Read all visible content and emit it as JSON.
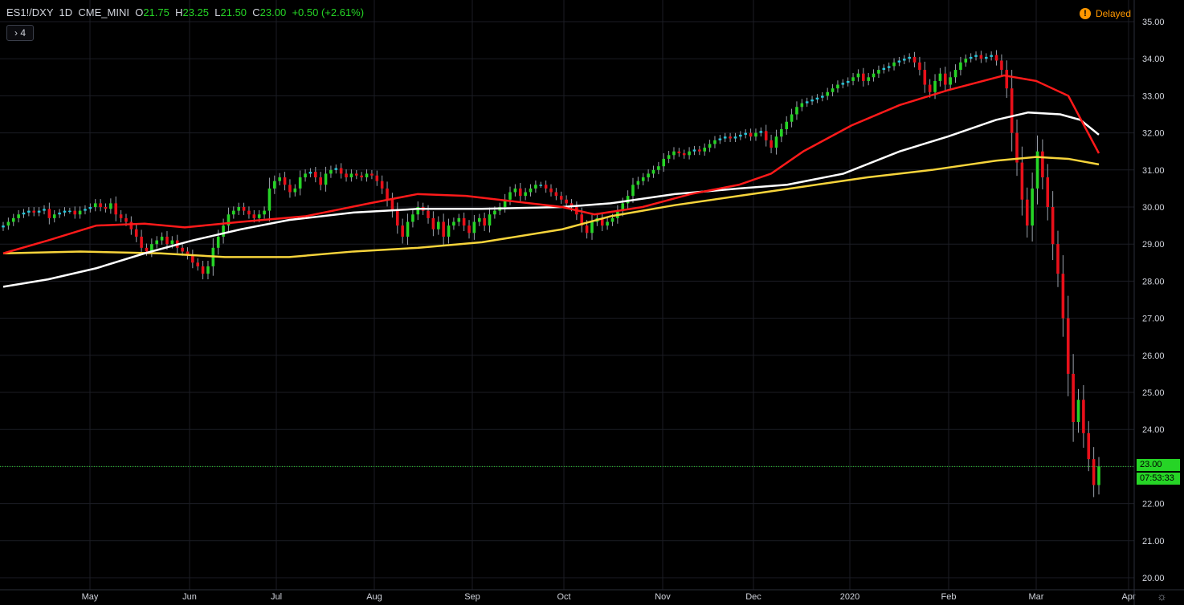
{
  "header": {
    "symbol": "ES1!/DXY",
    "interval": "1D",
    "exchange": "CME_MINI",
    "o_label": "O",
    "o": "21.75",
    "h_label": "H",
    "h": "23.25",
    "l_label": "L",
    "l": "21.50",
    "c_label": "C",
    "c": "23.00",
    "change": "+0.50 (+2.61%)",
    "indicator_toggle": "› 4",
    "delayed": "Delayed"
  },
  "price_tag": {
    "last": "23.00",
    "countdown": "07:53:33"
  },
  "colors": {
    "up": "#26d426",
    "down": "#e8101a",
    "up_weak": "#26c6da",
    "ma_red": "#ff1a1a",
    "ma_white": "#ffffff",
    "ma_yellow": "#f7d43b",
    "grid": "#1b1d24",
    "axis_text": "#d1d4dc",
    "last_line": "#26d426"
  },
  "chart_data": {
    "type": "candlestick",
    "y_ticks": [
      "20.00",
      "21.00",
      "22.00",
      "23.00",
      "24.00",
      "25.00",
      "26.00",
      "27.00",
      "28.00",
      "29.00",
      "30.00",
      "31.00",
      "32.00",
      "33.00",
      "34.00",
      "35.00"
    ],
    "x_labels": [
      "May",
      "Jun",
      "Jul",
      "Aug",
      "Sep",
      "Oct",
      "Nov",
      "Dec",
      "2020",
      "Feb",
      "Mar",
      "Apr"
    ],
    "ylim": [
      20,
      35.3
    ],
    "last_price": 23.0,
    "closes": [
      29.5,
      29.6,
      29.7,
      29.8,
      29.85,
      29.9,
      29.85,
      29.9,
      29.95,
      29.7,
      29.8,
      29.85,
      29.9,
      29.9,
      29.8,
      29.9,
      29.95,
      30.0,
      30.1,
      30.0,
      29.95,
      30.1,
      29.8,
      29.7,
      29.6,
      29.4,
      29.2,
      28.9,
      28.8,
      29.0,
      29.1,
      29.2,
      29.0,
      29.1,
      28.9,
      28.8,
      28.7,
      28.5,
      28.4,
      28.2,
      28.4,
      28.9,
      29.2,
      29.5,
      29.8,
      29.9,
      30.0,
      29.9,
      29.8,
      29.7,
      29.8,
      29.9,
      30.5,
      30.7,
      30.8,
      30.6,
      30.4,
      30.5,
      30.8,
      30.9,
      30.95,
      30.8,
      30.6,
      30.9,
      31.0,
      31.05,
      30.9,
      30.8,
      30.9,
      30.85,
      30.8,
      30.9,
      30.85,
      30.7,
      30.5,
      30.2,
      29.9,
      29.5,
      29.2,
      29.6,
      29.8,
      30.0,
      29.9,
      29.7,
      29.4,
      29.6,
      29.2,
      29.5,
      29.6,
      29.7,
      29.5,
      29.3,
      29.6,
      29.7,
      29.5,
      29.8,
      29.9,
      30.0,
      30.2,
      30.4,
      30.5,
      30.3,
      30.4,
      30.5,
      30.6,
      30.6,
      30.5,
      30.4,
      30.3,
      30.2,
      30.1,
      30.0,
      29.8,
      29.5,
      29.3,
      29.6,
      29.7,
      29.5,
      29.6,
      29.7,
      29.9,
      30.1,
      30.3,
      30.6,
      30.7,
      30.8,
      30.9,
      31.0,
      31.1,
      31.3,
      31.4,
      31.5,
      31.45,
      31.4,
      31.5,
      31.55,
      31.5,
      31.6,
      31.7,
      31.8,
      31.85,
      31.9,
      31.85,
      31.9,
      31.95,
      32.0,
      31.9,
      32.0,
      32.05,
      31.8,
      31.6,
      31.9,
      32.1,
      32.3,
      32.5,
      32.7,
      32.8,
      32.85,
      32.9,
      32.95,
      33.0,
      33.1,
      33.2,
      33.3,
      33.35,
      33.4,
      33.5,
      33.6,
      33.4,
      33.5,
      33.6,
      33.7,
      33.75,
      33.8,
      33.9,
      33.95,
      34.0,
      34.05,
      33.9,
      33.7,
      33.3,
      33.1,
      33.4,
      33.6,
      33.3,
      33.5,
      33.7,
      33.9,
      34.0,
      34.05,
      34.1,
      34.0,
      34.05,
      34.1,
      33.95,
      33.7,
      33.2,
      32.0,
      31.2,
      30.2,
      29.5,
      30.5,
      31.5,
      30.8,
      30.0,
      29.0,
      28.2,
      27.0,
      25.5,
      24.2,
      24.8,
      23.9,
      23.2,
      22.5,
      23.0
    ],
    "ma_red": {
      "start": 28.7,
      "shape": "peaks ~30.3 Aug, ~33.5 Feb, ends 31.45"
    },
    "ma_white": {
      "start": 27.85,
      "end": 31.95
    },
    "ma_yellow": {
      "start": 28.75,
      "end": 31.15
    }
  }
}
